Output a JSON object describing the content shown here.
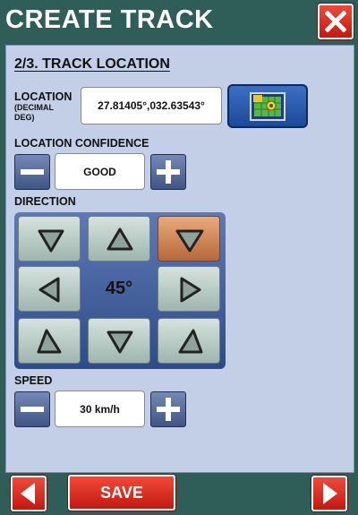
{
  "header": {
    "title": "CREATE TRACK"
  },
  "section": {
    "title": "2/3. TRACK LOCATION"
  },
  "location": {
    "label": "LOCATION",
    "sublabel_line1": "(DECIMAL",
    "sublabel_line2": "DEG)",
    "value": "27.81405°,032.63543°"
  },
  "confidence": {
    "label": "LOCATION CONFIDENCE",
    "value": "GOOD"
  },
  "direction": {
    "label": "DIRECTION",
    "value": "45°",
    "active_arrow": "top-right"
  },
  "speed": {
    "label": "SPEED",
    "value": "30 km/h"
  },
  "footer": {
    "save_label": "SAVE"
  },
  "colors": {
    "background": "#2f5d58",
    "panel": "#c3cfe6",
    "accent_red": "#d9251a",
    "active_direction": "#d88a55"
  },
  "icons": {
    "close": "close-icon",
    "map": "map-icon",
    "minus": "minus-icon",
    "plus": "plus-icon",
    "back": "arrow-left-icon",
    "next": "arrow-right-icon"
  }
}
